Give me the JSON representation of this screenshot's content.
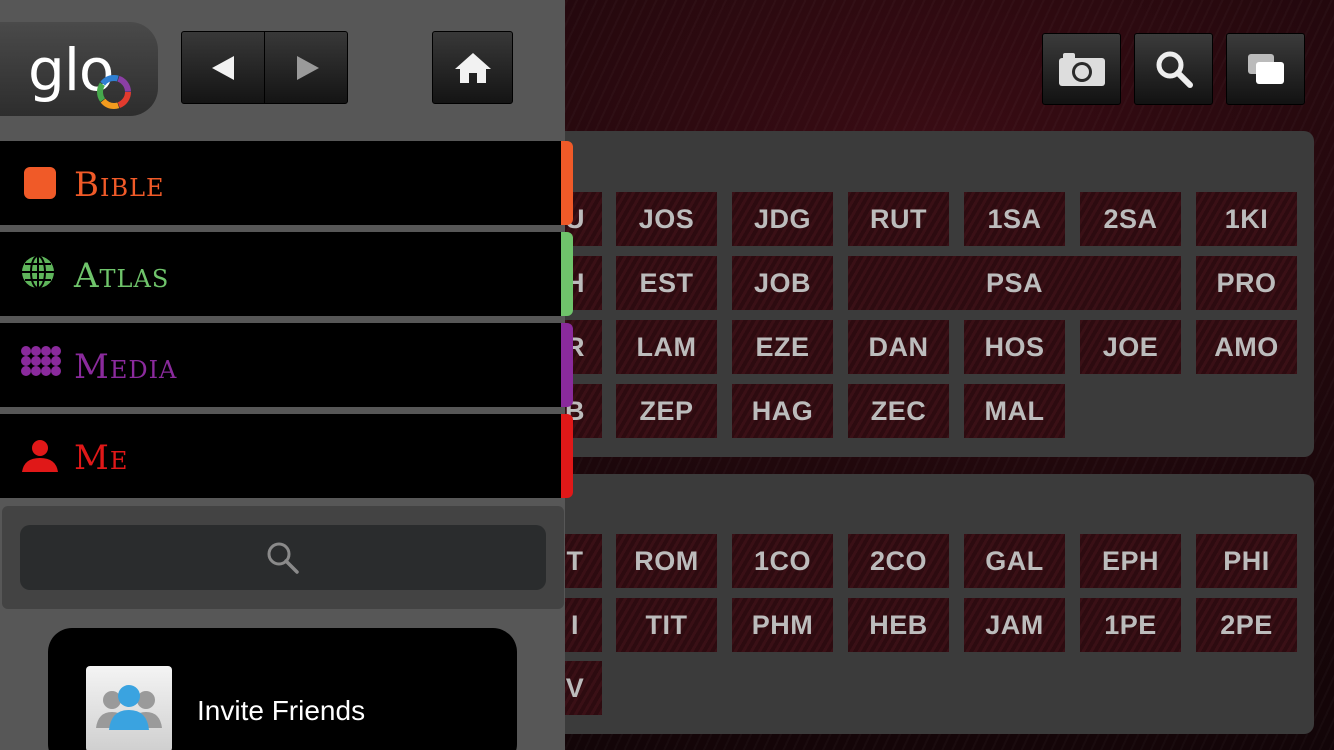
{
  "logo": {
    "text": "glo",
    "ring_colors": [
      "#e23b2e",
      "#f29b1e",
      "#46a94c",
      "#2f7fd1",
      "#8b3fa5"
    ]
  },
  "toolbar": {
    "icons": [
      "camera-icon",
      "search-icon",
      "windows-icon"
    ]
  },
  "navigation": {
    "back_icon": "left-arrow",
    "forward_icon": "right-arrow",
    "home_icon": "home-icon"
  },
  "menu": {
    "items": [
      {
        "label": "Bible",
        "color": "#f05a28",
        "icon": "bible-square-icon"
      },
      {
        "label": "Atlas",
        "color": "#6fc46b",
        "icon": "globe-icon"
      },
      {
        "label": "Media",
        "color": "#8a2a9c",
        "icon": "media-grid-icon"
      },
      {
        "label": "Me",
        "color": "#e01818",
        "icon": "person-icon"
      }
    ]
  },
  "search": {
    "icon": "search-icon"
  },
  "invite": {
    "label": "Invite Friends",
    "icon": "contacts-icon"
  },
  "old_testament": {
    "partial": [
      "U",
      "H",
      "R",
      "B"
    ],
    "rows": [
      [
        "JOS",
        "JDG",
        "RUT",
        "1SA",
        "2SA",
        "1KI"
      ],
      [
        "EST",
        "JOB",
        "PSA",
        "PRO"
      ],
      [
        "LAM",
        "EZE",
        "DAN",
        "HOS",
        "JOE",
        "AMO"
      ],
      [
        "ZEP",
        "HAG",
        "ZEC",
        "MAL"
      ]
    ]
  },
  "new_testament": {
    "partial": [
      "T",
      "I",
      "V"
    ],
    "rows": [
      [
        "ROM",
        "1CO",
        "2CO",
        "GAL",
        "EPH",
        "PHI"
      ],
      [
        "TIT",
        "PHM",
        "HEB",
        "JAM",
        "1PE",
        "2PE"
      ]
    ]
  }
}
